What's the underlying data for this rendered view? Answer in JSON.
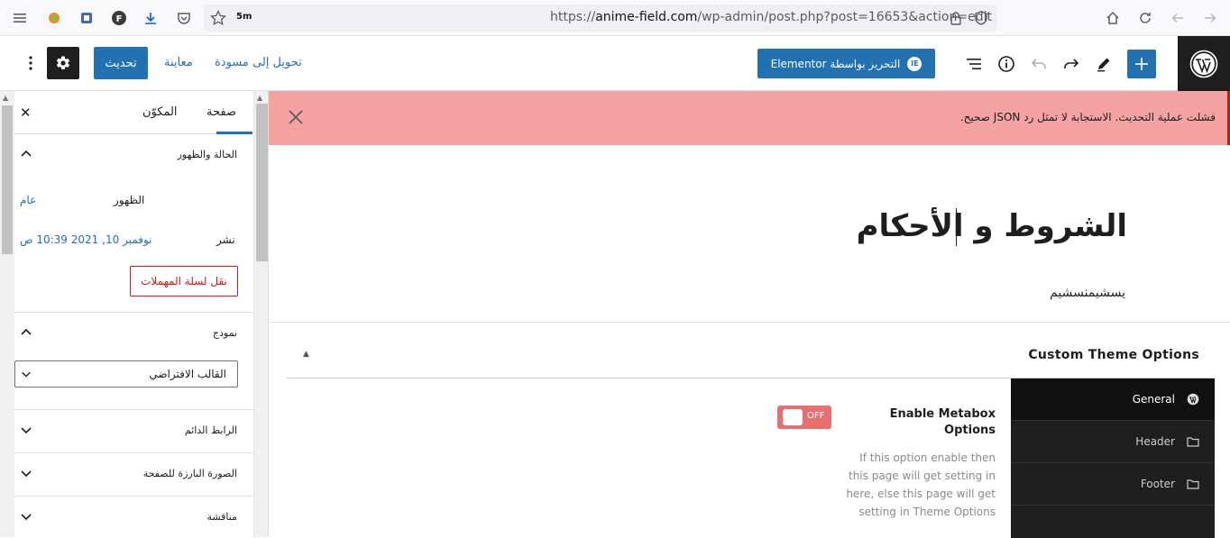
{
  "browser": {
    "tab_count": "5m",
    "url_prefix": "https://",
    "url_domain": "anime-field.com",
    "url_path": "/wp-admin/post.php?post=16653&action=edit"
  },
  "header": {
    "elementor_label": "التحرير بواسطة Elementor",
    "elementor_icon_text": "IE",
    "switch_to_draft": "تحويل إلى مسودة",
    "preview": "معاينة",
    "update": "تحديث"
  },
  "sidebar": {
    "tabs": {
      "page": "صفحة",
      "block": "المكوّن"
    },
    "status": {
      "title": "الحالة والظهور",
      "visibility_label": "الظهور",
      "visibility_value": "عام",
      "publish_label": "نشر",
      "publish_value": "نوفمبر 10, 2021 10:39 ص",
      "trash_button": "نقل لسلة المهملات"
    },
    "template": {
      "title": "نموذج",
      "selected": "القالب الافتراضي"
    },
    "panels": [
      {
        "title": "الرابط الدائم"
      },
      {
        "title": "الصورة البارزة للصفحة"
      },
      {
        "title": "مناقشة"
      }
    ]
  },
  "notice": {
    "text": "فشلت عملية التحديث. الاستجابة لا تمثل رد JSON صحيح."
  },
  "editor": {
    "title": "الشروط و الأحكام",
    "paragraph": "يسشيمنسشيم"
  },
  "metabox": {
    "title": "Custom Theme Options",
    "nav": [
      {
        "label": "General",
        "icon": "wordpress-icon",
        "active": true
      },
      {
        "label": "Header",
        "icon": "folder-icon",
        "active": false
      },
      {
        "label": "Footer",
        "icon": "folder-icon",
        "active": false
      }
    ],
    "option": {
      "label": "Enable Metabox Options",
      "toggle_state": "OFF",
      "description": "If this option enable then this page will get setting in here, else this page will get setting in Theme Options"
    }
  },
  "colors": {
    "wp_blue": "#2271b1",
    "notice_bg": "#f4a2a2",
    "error_red": "#cc1818",
    "toggle_off": "#e76f6f",
    "dark": "#1e1e1e"
  }
}
